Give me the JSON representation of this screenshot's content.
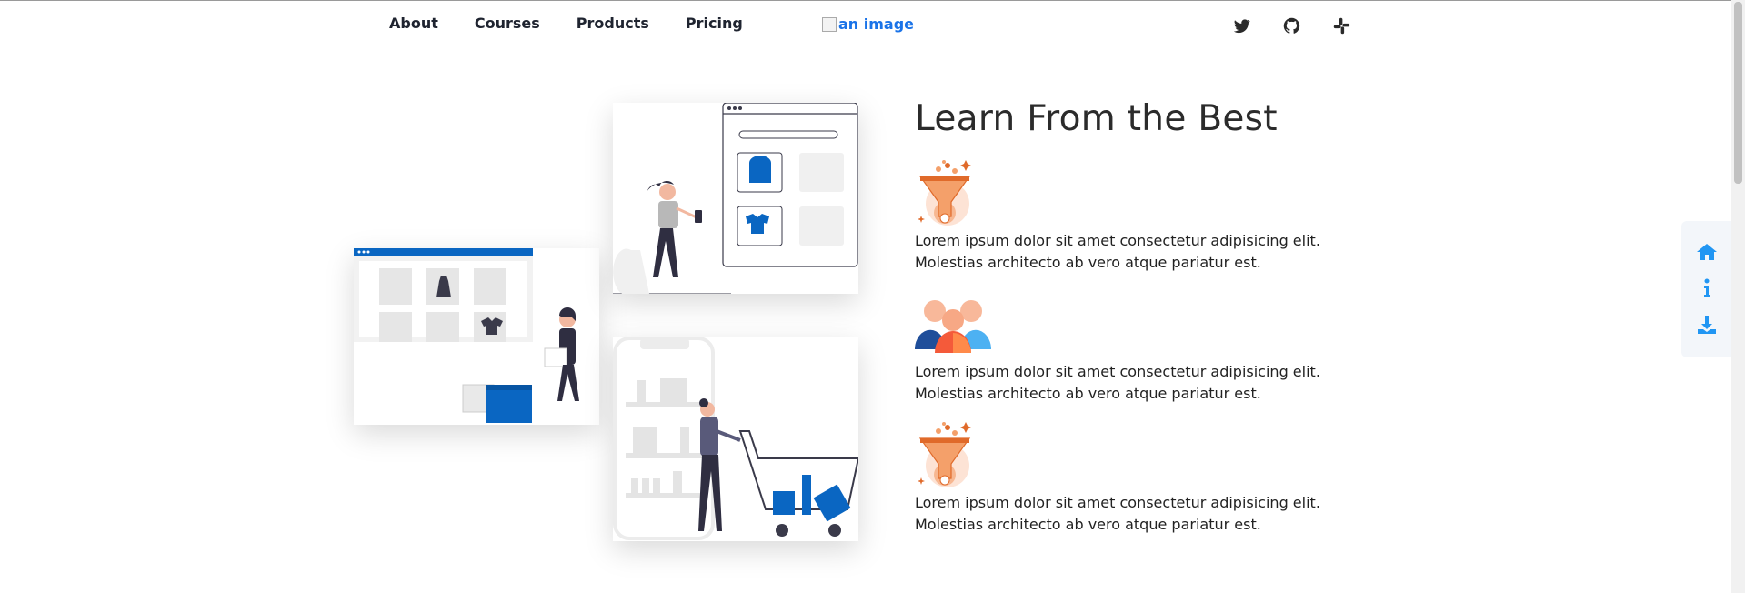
{
  "nav": {
    "items": [
      "About",
      "Courses",
      "Products",
      "Pricing"
    ]
  },
  "logo": {
    "alt": "an image"
  },
  "social": {
    "icons": [
      "twitter-icon",
      "github-icon",
      "slack-icon"
    ]
  },
  "section": {
    "title": "Learn From the Best",
    "features": [
      {
        "icon": "funnel-icon",
        "line1": "Lorem ipsum dolor sit amet consectetur adipisicing elit.",
        "line2": "Molestias architecto ab vero atque pariatur est."
      },
      {
        "icon": "team-icon",
        "line1": "Lorem ipsum dolor sit amet consectetur adipisicing elit.",
        "line2": "Molestias architecto ab vero atque pariatur est."
      },
      {
        "icon": "funnel-icon",
        "line1": "Lorem ipsum dolor sit amet consectetur adipisicing elit.",
        "line2": "Molestias architecto ab vero atque pariatur est."
      }
    ]
  },
  "sidebar": {
    "icons": [
      "home-icon",
      "info-icon",
      "download-icon"
    ]
  },
  "colors": {
    "accent": "#0a66c2",
    "icon_blue": "#2196f3",
    "orange": "#f07c3a"
  }
}
